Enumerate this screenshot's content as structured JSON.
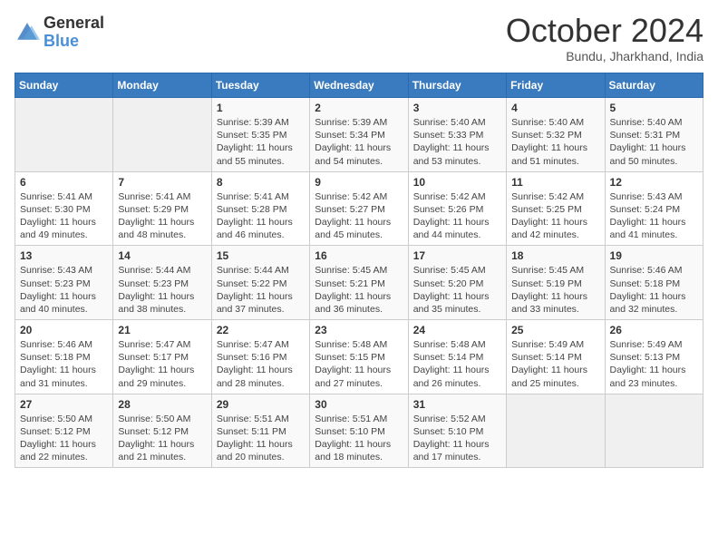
{
  "logo": {
    "line1": "General",
    "line2": "Blue"
  },
  "title": "October 2024",
  "subtitle": "Bundu, Jharkhand, India",
  "weekdays": [
    "Sunday",
    "Monday",
    "Tuesday",
    "Wednesday",
    "Thursday",
    "Friday",
    "Saturday"
  ],
  "weeks": [
    [
      {
        "day": "",
        "sunrise": "",
        "sunset": "",
        "daylight": ""
      },
      {
        "day": "",
        "sunrise": "",
        "sunset": "",
        "daylight": ""
      },
      {
        "day": "1",
        "sunrise": "Sunrise: 5:39 AM",
        "sunset": "Sunset: 5:35 PM",
        "daylight": "Daylight: 11 hours and 55 minutes."
      },
      {
        "day": "2",
        "sunrise": "Sunrise: 5:39 AM",
        "sunset": "Sunset: 5:34 PM",
        "daylight": "Daylight: 11 hours and 54 minutes."
      },
      {
        "day": "3",
        "sunrise": "Sunrise: 5:40 AM",
        "sunset": "Sunset: 5:33 PM",
        "daylight": "Daylight: 11 hours and 53 minutes."
      },
      {
        "day": "4",
        "sunrise": "Sunrise: 5:40 AM",
        "sunset": "Sunset: 5:32 PM",
        "daylight": "Daylight: 11 hours and 51 minutes."
      },
      {
        "day": "5",
        "sunrise": "Sunrise: 5:40 AM",
        "sunset": "Sunset: 5:31 PM",
        "daylight": "Daylight: 11 hours and 50 minutes."
      }
    ],
    [
      {
        "day": "6",
        "sunrise": "Sunrise: 5:41 AM",
        "sunset": "Sunset: 5:30 PM",
        "daylight": "Daylight: 11 hours and 49 minutes."
      },
      {
        "day": "7",
        "sunrise": "Sunrise: 5:41 AM",
        "sunset": "Sunset: 5:29 PM",
        "daylight": "Daylight: 11 hours and 48 minutes."
      },
      {
        "day": "8",
        "sunrise": "Sunrise: 5:41 AM",
        "sunset": "Sunset: 5:28 PM",
        "daylight": "Daylight: 11 hours and 46 minutes."
      },
      {
        "day": "9",
        "sunrise": "Sunrise: 5:42 AM",
        "sunset": "Sunset: 5:27 PM",
        "daylight": "Daylight: 11 hours and 45 minutes."
      },
      {
        "day": "10",
        "sunrise": "Sunrise: 5:42 AM",
        "sunset": "Sunset: 5:26 PM",
        "daylight": "Daylight: 11 hours and 44 minutes."
      },
      {
        "day": "11",
        "sunrise": "Sunrise: 5:42 AM",
        "sunset": "Sunset: 5:25 PM",
        "daylight": "Daylight: 11 hours and 42 minutes."
      },
      {
        "day": "12",
        "sunrise": "Sunrise: 5:43 AM",
        "sunset": "Sunset: 5:24 PM",
        "daylight": "Daylight: 11 hours and 41 minutes."
      }
    ],
    [
      {
        "day": "13",
        "sunrise": "Sunrise: 5:43 AM",
        "sunset": "Sunset: 5:23 PM",
        "daylight": "Daylight: 11 hours and 40 minutes."
      },
      {
        "day": "14",
        "sunrise": "Sunrise: 5:44 AM",
        "sunset": "Sunset: 5:23 PM",
        "daylight": "Daylight: 11 hours and 38 minutes."
      },
      {
        "day": "15",
        "sunrise": "Sunrise: 5:44 AM",
        "sunset": "Sunset: 5:22 PM",
        "daylight": "Daylight: 11 hours and 37 minutes."
      },
      {
        "day": "16",
        "sunrise": "Sunrise: 5:45 AM",
        "sunset": "Sunset: 5:21 PM",
        "daylight": "Daylight: 11 hours and 36 minutes."
      },
      {
        "day": "17",
        "sunrise": "Sunrise: 5:45 AM",
        "sunset": "Sunset: 5:20 PM",
        "daylight": "Daylight: 11 hours and 35 minutes."
      },
      {
        "day": "18",
        "sunrise": "Sunrise: 5:45 AM",
        "sunset": "Sunset: 5:19 PM",
        "daylight": "Daylight: 11 hours and 33 minutes."
      },
      {
        "day": "19",
        "sunrise": "Sunrise: 5:46 AM",
        "sunset": "Sunset: 5:18 PM",
        "daylight": "Daylight: 11 hours and 32 minutes."
      }
    ],
    [
      {
        "day": "20",
        "sunrise": "Sunrise: 5:46 AM",
        "sunset": "Sunset: 5:18 PM",
        "daylight": "Daylight: 11 hours and 31 minutes."
      },
      {
        "day": "21",
        "sunrise": "Sunrise: 5:47 AM",
        "sunset": "Sunset: 5:17 PM",
        "daylight": "Daylight: 11 hours and 29 minutes."
      },
      {
        "day": "22",
        "sunrise": "Sunrise: 5:47 AM",
        "sunset": "Sunset: 5:16 PM",
        "daylight": "Daylight: 11 hours and 28 minutes."
      },
      {
        "day": "23",
        "sunrise": "Sunrise: 5:48 AM",
        "sunset": "Sunset: 5:15 PM",
        "daylight": "Daylight: 11 hours and 27 minutes."
      },
      {
        "day": "24",
        "sunrise": "Sunrise: 5:48 AM",
        "sunset": "Sunset: 5:14 PM",
        "daylight": "Daylight: 11 hours and 26 minutes."
      },
      {
        "day": "25",
        "sunrise": "Sunrise: 5:49 AM",
        "sunset": "Sunset: 5:14 PM",
        "daylight": "Daylight: 11 hours and 25 minutes."
      },
      {
        "day": "26",
        "sunrise": "Sunrise: 5:49 AM",
        "sunset": "Sunset: 5:13 PM",
        "daylight": "Daylight: 11 hours and 23 minutes."
      }
    ],
    [
      {
        "day": "27",
        "sunrise": "Sunrise: 5:50 AM",
        "sunset": "Sunset: 5:12 PM",
        "daylight": "Daylight: 11 hours and 22 minutes."
      },
      {
        "day": "28",
        "sunrise": "Sunrise: 5:50 AM",
        "sunset": "Sunset: 5:12 PM",
        "daylight": "Daylight: 11 hours and 21 minutes."
      },
      {
        "day": "29",
        "sunrise": "Sunrise: 5:51 AM",
        "sunset": "Sunset: 5:11 PM",
        "daylight": "Daylight: 11 hours and 20 minutes."
      },
      {
        "day": "30",
        "sunrise": "Sunrise: 5:51 AM",
        "sunset": "Sunset: 5:10 PM",
        "daylight": "Daylight: 11 hours and 18 minutes."
      },
      {
        "day": "31",
        "sunrise": "Sunrise: 5:52 AM",
        "sunset": "Sunset: 5:10 PM",
        "daylight": "Daylight: 11 hours and 17 minutes."
      },
      {
        "day": "",
        "sunrise": "",
        "sunset": "",
        "daylight": ""
      },
      {
        "day": "",
        "sunrise": "",
        "sunset": "",
        "daylight": ""
      }
    ]
  ]
}
